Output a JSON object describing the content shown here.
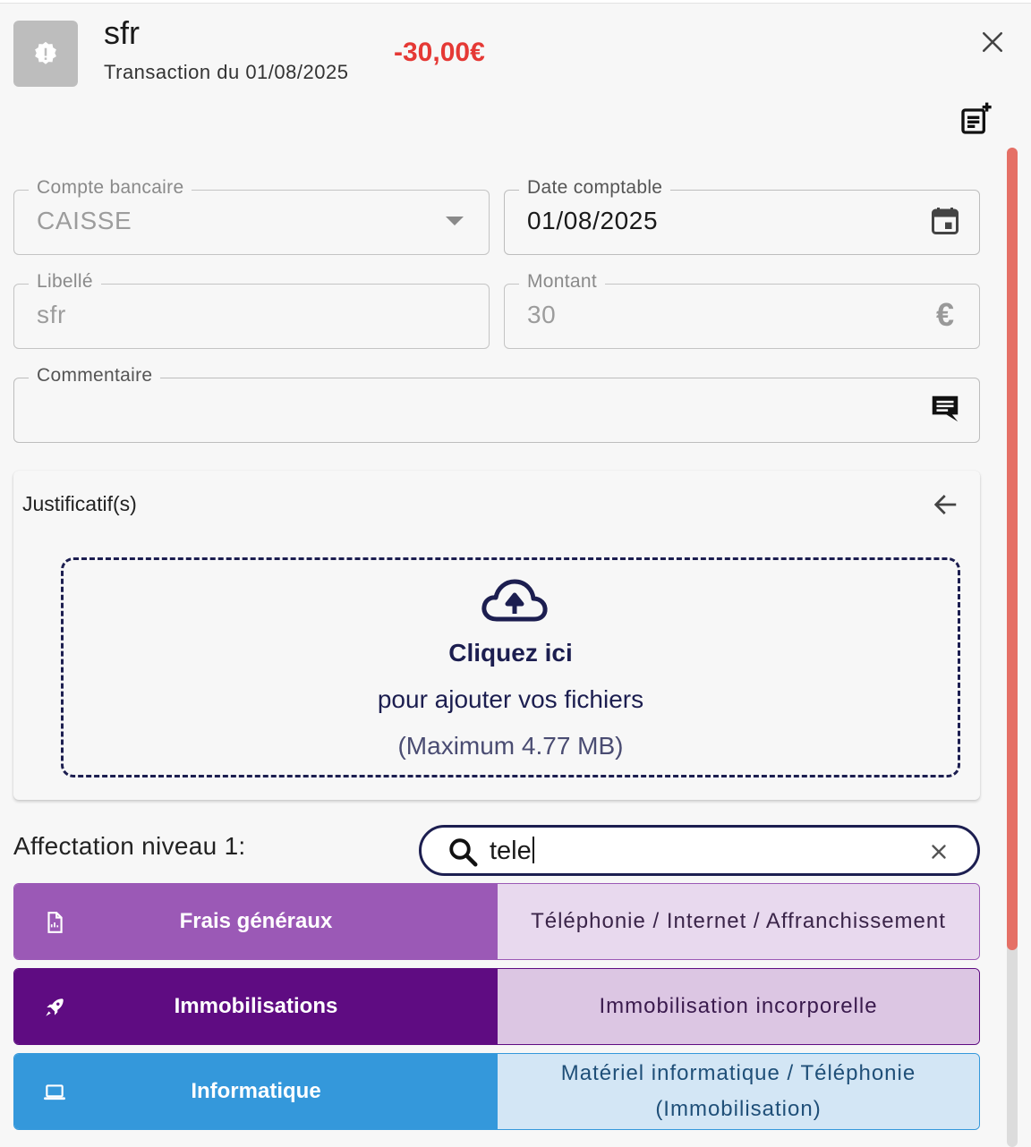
{
  "header": {
    "title": "sfr",
    "subtitle": "Transaction du 01/08/2025",
    "amount": "-30,00€",
    "amount_color": "#e53935",
    "avatar_icon": "alert-badge-icon",
    "close_icon": "close-icon",
    "note_icon": "note-add-icon"
  },
  "form": {
    "compte": {
      "label": "Compte bancaire",
      "value": "CAISSE",
      "icon": "chevron-down-icon"
    },
    "date": {
      "label": "Date comptable",
      "value": "01/08/2025",
      "icon": "calendar-icon"
    },
    "libelle": {
      "label": "Libellé",
      "value": "sfr"
    },
    "montant": {
      "label": "Montant",
      "value": "30",
      "icon": "euro-icon"
    },
    "commentaire": {
      "label": "Commentaire",
      "value": "",
      "icon": "comment-icon"
    }
  },
  "justificatif": {
    "title": "Justificatif(s)",
    "back_icon": "arrow-left-icon",
    "upload_icon": "cloud-upload-icon",
    "line1": "Cliquez ici",
    "line2": "pour ajouter vos fichiers",
    "line3": "(Maximum 4.77 MB)"
  },
  "affectation": {
    "label": "Affectation niveau 1:",
    "search_value": "tele",
    "search_icon": "search-icon",
    "clear_icon": "clear-icon",
    "categories": [
      {
        "name": "Frais généraux",
        "sub": "Téléphonie / Internet / Affranchissement",
        "icon": "document-icon",
        "color": "#9b59b6",
        "light": "#e8d9ee",
        "text": "#3a2448"
      },
      {
        "name": "Immobilisations",
        "sub": "Immobilisation incorporelle",
        "icon": "rocket-icon",
        "color": "#5f0c82",
        "light": "#dcc6e3",
        "text": "#3a1a4d"
      },
      {
        "name": "Informatique",
        "sub": "Matériel informatique / Téléphonie (Immobilisation)",
        "icon": "laptop-icon",
        "color": "#3498db",
        "light": "#d3e6f5",
        "text": "#1f4f78"
      }
    ]
  }
}
